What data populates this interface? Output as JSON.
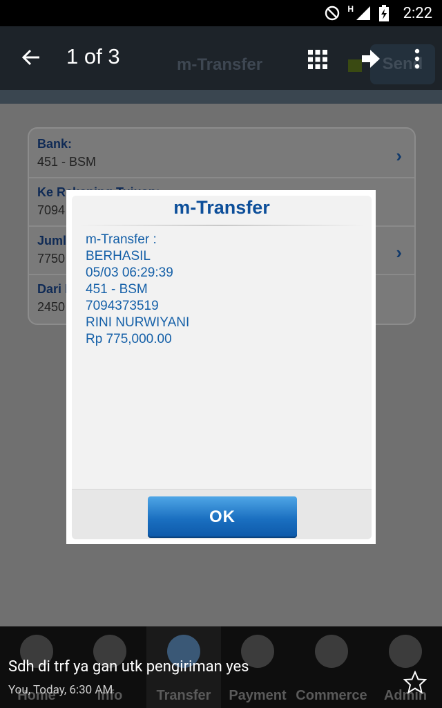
{
  "status_bar": {
    "time": "2:22",
    "network_label": "H"
  },
  "app_bar": {
    "back_icon": "arrow-left-icon",
    "title": "1 of 3",
    "ghost_title": "m-Transfer",
    "ghost_send": "Send"
  },
  "form": {
    "rows": [
      {
        "label": "Bank:",
        "value": "451 - BSM",
        "has_chevron": true
      },
      {
        "label": "Ke Rekening Tujuan:",
        "value": "7094",
        "has_chevron": false
      },
      {
        "label": "Juml",
        "value": "7750",
        "has_chevron": true
      },
      {
        "label": "Dari I",
        "value": "2450",
        "has_chevron": false
      }
    ]
  },
  "dialog": {
    "title": "m-Transfer",
    "lines": [
      "m-Transfer :",
      "BERHASIL",
      "05/03 06:29:39",
      "451 - BSM",
      "7094373519",
      "RINI NURWIYANI",
      "Rp 775,000.00"
    ],
    "ok_label": "OK"
  },
  "bottom_nav": {
    "items": [
      {
        "label": "Home",
        "icon": "home-icon"
      },
      {
        "label": "Info",
        "icon": "info-icon"
      },
      {
        "label": "Transfer",
        "icon": "transfer-icon"
      },
      {
        "label": "Payment",
        "icon": "printer-icon"
      },
      {
        "label": "Commerce",
        "icon": "globe-icon"
      },
      {
        "label": "Admin",
        "icon": "person-icon"
      }
    ]
  },
  "notification": {
    "message": "Sdh di trf ya gan utk pengiriman yes",
    "meta": "You, Today, 6:30 AM"
  },
  "colors": {
    "accent": "#0d4f9a",
    "dialog_text": "#1560a8",
    "ok_button": "#1a6fc0"
  }
}
